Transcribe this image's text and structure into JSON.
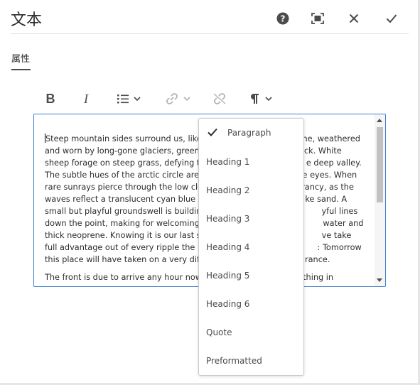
{
  "dialog": {
    "title": "文本",
    "header_buttons": [
      {
        "name": "help",
        "icon": "help-icon"
      },
      {
        "name": "fullscreen",
        "icon": "fullscreen-icon"
      },
      {
        "name": "cancel",
        "icon": "close-icon"
      },
      {
        "name": "done",
        "icon": "checkmark-icon"
      }
    ]
  },
  "tabs": [
    {
      "label": "属性",
      "active": true
    }
  ],
  "toolbar": {
    "bold_label": "B",
    "italic_label": "I",
    "buttons": [
      {
        "name": "bold",
        "icon": "bold-icon"
      },
      {
        "name": "italic",
        "icon": "italic-icon"
      },
      {
        "name": "list",
        "icon": "list-icon",
        "has_dropdown": true
      },
      {
        "name": "link",
        "icon": "link-icon",
        "has_dropdown": true,
        "disabled": true
      },
      {
        "name": "unlink",
        "icon": "unlink-icon",
        "disabled": true
      },
      {
        "name": "paragraph-format",
        "icon": "pilcrow-icon",
        "has_dropdown": true
      }
    ]
  },
  "editor": {
    "paragraph1": "Steep mountain sides surround us, like w                                   ine, weathered and worn by long-gone glaciers, green m                                   ock. White sheep forage on steep grass, defying the c                                   e deep valley. The subtle hues of the arctic circle are we                                   e eyes. When rare sunrays pierce through the low clouc                                   rancy, as the waves reflect a translucent cyan blue befo                                   ke sand. A small but playful groundswell is building, the o                                   yful lines down the point, making for welcoming conditic                                   water and thick neoprene. Knowing it is our last surf befo                                   ve take full advantage out of every ripple the North A                                   : Tomorrow this place will have taken on a very differ                                   arance.",
    "paragraph2": "The front is due to arrive any hour now, w                                   thing in"
  },
  "format_menu": {
    "selected": "Paragraph",
    "items": [
      "Paragraph",
      "Heading 1",
      "Heading 2",
      "Heading 3",
      "Heading 4",
      "Heading 5",
      "Heading 6",
      "Quote",
      "Preformatted"
    ]
  },
  "colors": {
    "accent_border": "#3d7fd2",
    "icon": "#4b4b4b",
    "disabled_icon": "#b3b3b3"
  }
}
